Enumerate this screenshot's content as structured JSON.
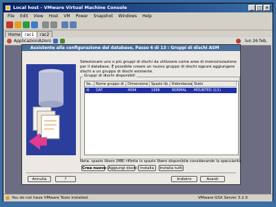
{
  "window": {
    "title": "Local host - VMware Virtual Machine Console",
    "controls": [
      "_",
      "□",
      "×"
    ]
  },
  "menu": [
    "File",
    "Edit",
    "View",
    "Host",
    "VM",
    "Power",
    "Snapshot",
    "Windows",
    "Help"
  ],
  "tabs": [
    "Home",
    "rac1",
    "rac2"
  ],
  "guest_panel": {
    "items": [
      "Applicazioni",
      "Azioni"
    ],
    "clock": "lun 26 feb,"
  },
  "dialog": {
    "title": "Assistente alla configurazione del database, Passo 6 di 13 : Gruppi di dischi ASM",
    "intro": "Selezionare uno o più gruppi di dischi da utilizzare come aree di memorizzazione per il database. È possibile creare un nuovo gruppo di dischi oppure aggiungere dischi a un gruppo di dischi esistente.",
    "group_label": "Gruppi di dischi disponibili",
    "columns": [
      "Se...",
      "Nome gruppo di ...",
      "Dimensione ...",
      "Spazio lib...",
      "Ridondanza",
      "Stato"
    ],
    "rows": [
      {
        "check": "☒",
        "name": "DAT",
        "size": "4094",
        "free": "1996",
        "redundancy": "NORMAL",
        "state": "MOUNTED (1/1)"
      }
    ],
    "note": "Nota: spazio libero (MB) riflette lo spazio libero disponibile considerando la specularità.",
    "buttons": {
      "create": "Crea nuovo",
      "add_disks": "Aggiungi dischi",
      "info": "Installa",
      "mount_all": "Installa tutti",
      "cancel": "Annulla",
      "help": "?",
      "back": "Indietro",
      "next": "Avanti"
    }
  },
  "statusbar": {
    "message": "You do not have VMware Tools installed.",
    "version": "VMware GSX Server 3.2.0"
  }
}
